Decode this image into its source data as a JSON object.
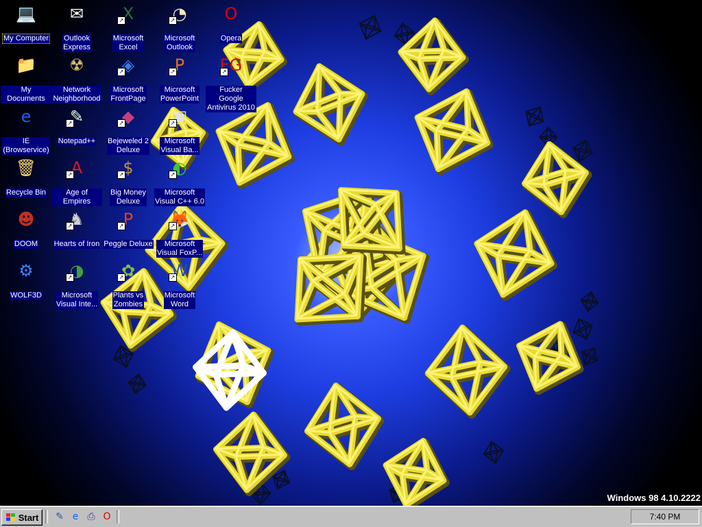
{
  "desktop": {
    "icons": [
      {
        "label": "My Computer",
        "glyph": "💻",
        "color": "#ffd400",
        "shortcut": false,
        "selected": true
      },
      {
        "label": "Outlook\nExpress",
        "glyph": "✉",
        "color": "#ffffff",
        "shortcut": false
      },
      {
        "label": "Microsoft\nExcel",
        "glyph": "X",
        "color": "#1e7b34",
        "shortcut": true
      },
      {
        "label": "Microsoft\nOutlook",
        "glyph": "◔",
        "color": "#f2e8c0",
        "shortcut": true
      },
      {
        "label": "Opera",
        "glyph": "O",
        "color": "#e00000",
        "shortcut": false
      },
      {
        "label": "My Documents",
        "glyph": "📁",
        "color": "#ffe070",
        "shortcut": false
      },
      {
        "label": "Network\nNeighborhood",
        "glyph": "☢",
        "color": "#d8c060",
        "shortcut": false
      },
      {
        "label": "Microsoft\nFrontPage",
        "glyph": "◈",
        "color": "#3a7ae0",
        "shortcut": true
      },
      {
        "label": "Microsoft\nPowerPoint",
        "glyph": "P",
        "color": "#e07020",
        "shortcut": true
      },
      {
        "label": "Fucker Google\nAntivirus 2010",
        "glyph": "FG",
        "color": "#cc1010",
        "shortcut": true
      },
      {
        "label": "IE\n(Browservice)",
        "glyph": "e",
        "color": "#1060ff",
        "shortcut": false
      },
      {
        "label": "Notepad++",
        "glyph": "✎",
        "color": "#e0ffe0",
        "shortcut": true
      },
      {
        "label": "Bejeweled 2\nDeluxe",
        "glyph": "◆",
        "color": "#c04080",
        "shortcut": true
      },
      {
        "label": "Microsoft\nVisual Ba...",
        "glyph": "▣",
        "color": "#e0e0e0",
        "shortcut": true
      },
      {
        "label": "Recycle Bin",
        "glyph": "🗑",
        "color": "#f0d070",
        "shortcut": false
      },
      {
        "label": "Age of Empires",
        "glyph": "A",
        "color": "#d02020",
        "shortcut": true
      },
      {
        "label": "Big Money\nDeluxe",
        "glyph": "$",
        "color": "#c09040",
        "shortcut": true
      },
      {
        "label": "Microsoft\nVisual C++ 6.0",
        "glyph": "◐",
        "color": "#40c040",
        "shortcut": true
      },
      {
        "label": "DOOM",
        "glyph": "☻",
        "color": "#c03020",
        "shortcut": false
      },
      {
        "label": "Hearts of Iron",
        "glyph": "♞",
        "color": "#d0d0d0",
        "shortcut": true
      },
      {
        "label": "Peggle Deluxe",
        "glyph": "P",
        "color": "#e04020",
        "shortcut": true
      },
      {
        "label": "Microsoft\nVisual FoxP...",
        "glyph": "🦊",
        "color": "#e08020",
        "shortcut": true
      },
      {
        "label": "WOLF3D",
        "glyph": "⚙",
        "color": "#4080ff",
        "shortcut": false
      },
      {
        "label": "Microsoft\nVisual Inte...",
        "glyph": "◑",
        "color": "#40a040",
        "shortcut": true
      },
      {
        "label": "Plants vs\nZombies",
        "glyph": "✿",
        "color": "#80c040",
        "shortcut": true
      },
      {
        "label": "Microsoft\nWord",
        "glyph": "W",
        "color": "#2050c0",
        "shortcut": true
      }
    ],
    "version_text": "Windows 98 4.10.2222"
  },
  "taskbar": {
    "start_label": "Start",
    "quick_launch": [
      {
        "glyph": "✎",
        "color": "#2060a0"
      },
      {
        "glyph": "e",
        "color": "#1060ff"
      },
      {
        "glyph": "⎙",
        "color": "#4040a0"
      },
      {
        "glyph": "O",
        "color": "#e00000"
      }
    ],
    "clock": "7:40 PM"
  }
}
